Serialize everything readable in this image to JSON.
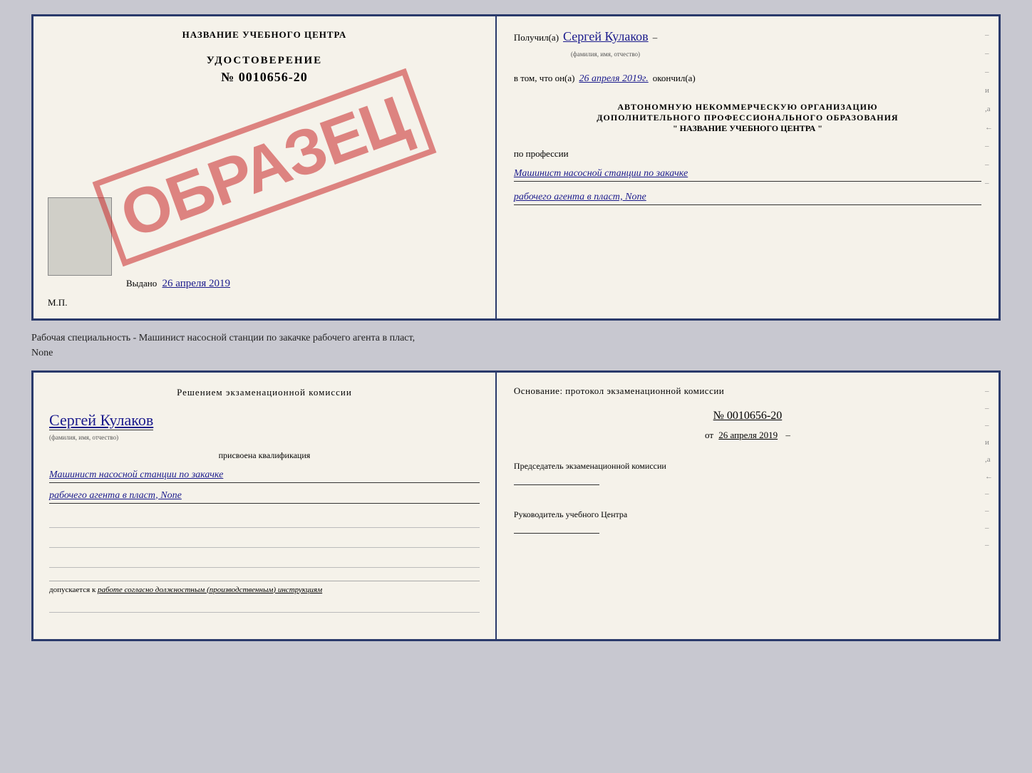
{
  "top_left": {
    "center_title": "НАЗВАНИЕ УЧЕБНОГО ЦЕНТРА",
    "stamp": "ОБРАЗЕЦ",
    "udostoverenie_title": "УДОСТОВЕРЕНИЕ",
    "udostoverenie_num": "№ 0010656-20",
    "vydano_label": "Выдано",
    "vydano_date": "26 апреля 2019",
    "mp_label": "М.П."
  },
  "top_right": {
    "poluchil_label": "Получил(а)",
    "poluchil_name": "Сергей Кулаков",
    "familiya_label": "(фамилия, имя, отчество)",
    "dash1": "–",
    "vtom_label": "в том, что он(а)",
    "vtom_date": "26 апреля 2019г.",
    "okonchil_label": "окончил(а)",
    "avt_line1": "АВТОНОМНУЮ НЕКОММЕРЧЕСКУЮ ОРГАНИЗАЦИЮ",
    "avt_line2": "ДОПОЛНИТЕЛЬНОГО ПРОФЕССИОНАЛЬНОГО ОБРАЗОВАНИЯ",
    "avt_line3": "\"  НАЗВАНИЕ УЧЕБНОГО ЦЕНТРА  \"",
    "po_professii": "по профессии",
    "profession_line1": "Машинист насосной станции по закачке",
    "profession_line2": "рабочего агента в пласт, None"
  },
  "specialty_text": {
    "line1": "Рабочая специальность - Машинист насосной станции по закачке рабочего агента в пласт,",
    "line2": "None"
  },
  "bottom_left": {
    "reshenie_title": "Решением экзаменационной комиссии",
    "name": "Сергей Кулаков",
    "familiya_label": "(фамилия, имя, отчество)",
    "prisvoena_label": "присвоена квалификация",
    "qualification_line1": "Машинист насосной станции по закачке",
    "qualification_line2": "рабочего агента в пласт, None",
    "dopuskaetsya_prefix": "допускается к",
    "dopuskaetsya_text": "работе согласно должностным (производственным) инструкциям"
  },
  "bottom_right": {
    "osnov_label": "Основание: протокол экзаменационной комиссии",
    "protocol_num": "№ 0010656-20",
    "ot_label": "от",
    "protocol_date": "26 апреля 2019",
    "dash": "–",
    "predsedatel_label": "Председатель экзаменационной комиссии",
    "rukov_label": "Руководитель учебного Центра"
  }
}
